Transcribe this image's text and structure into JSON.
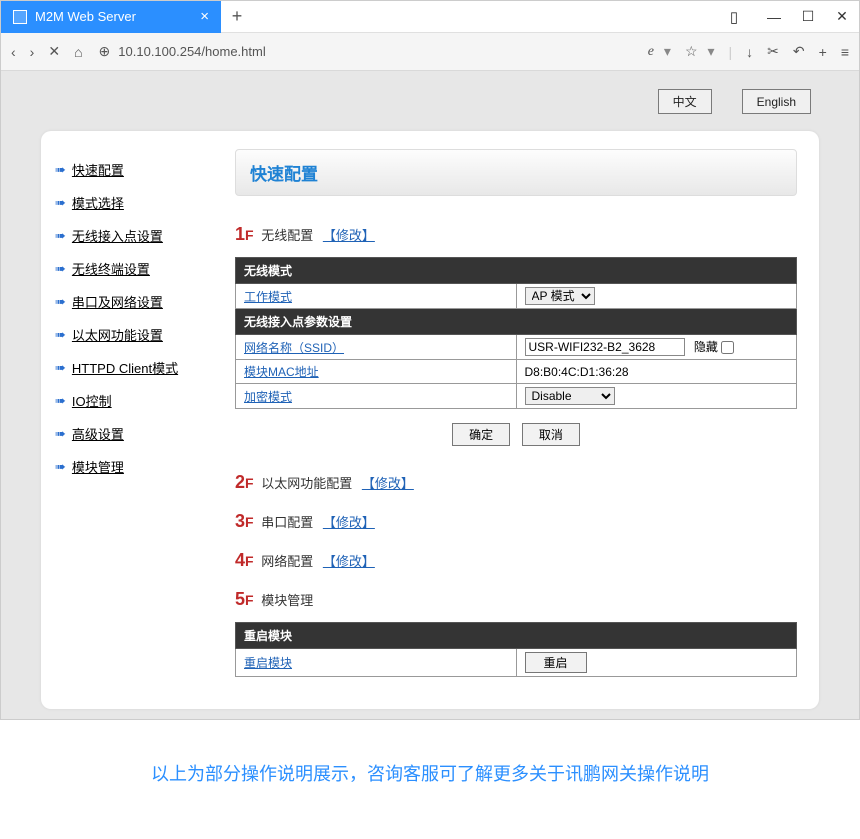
{
  "titlebar": {
    "tab_title": "M2M Web Server",
    "new_tab": "+",
    "close_tab": "×",
    "win_min": "—",
    "win_max": "☐",
    "win_close": "✕",
    "reader": "▯"
  },
  "toolbar": {
    "back": "‹",
    "forward": "›",
    "stop": "✕",
    "home": "⌂",
    "lock": "⊕",
    "url": "10.10.100.254/home.html",
    "compat": "e",
    "fav": "☆",
    "download": "↓",
    "cut": "✂",
    "undo": "↶",
    "plus": "+",
    "menu": "≡"
  },
  "lang": {
    "cn": "中文",
    "en": "English"
  },
  "sidebar": {
    "items": [
      {
        "label": "快速配置"
      },
      {
        "label": "模式选择"
      },
      {
        "label": "无线接入点设置"
      },
      {
        "label": "无线终端设置"
      },
      {
        "label": "串口及网络设置"
      },
      {
        "label": "以太网功能设置"
      },
      {
        "label": "HTTPD Client模式"
      },
      {
        "label": "IO控制"
      },
      {
        "label": "高级设置"
      },
      {
        "label": "模块管理"
      }
    ]
  },
  "main": {
    "title": "快速配置",
    "steps": {
      "s1": {
        "num": "1",
        "f": "F",
        "label": "无线配置",
        "edit": "【修改】"
      },
      "s2": {
        "num": "2",
        "f": "F",
        "label": "以太网功能配置",
        "edit": "【修改】"
      },
      "s3": {
        "num": "3",
        "f": "F",
        "label": "串口配置",
        "edit": "【修改】"
      },
      "s4": {
        "num": "4",
        "f": "F",
        "label": "网络配置",
        "edit": "【修改】"
      },
      "s5": {
        "num": "5",
        "f": "F",
        "label": "模块管理"
      }
    },
    "table1": {
      "hdr_mode": "无线模式",
      "row_workmode": "工作模式",
      "workmode_value": "AP 模式",
      "hdr_ap": "无线接入点参数设置",
      "row_ssid": "网络名称（SSID）",
      "ssid_value": "USR-WIFI232-B2_3628",
      "hide_label": "隐藏",
      "row_mac": "模块MAC地址",
      "mac_value": "D8:B0:4C:D1:36:28",
      "row_enc": "加密模式",
      "enc_value": "Disable"
    },
    "btns": {
      "ok": "确定",
      "cancel": "取消"
    },
    "table2": {
      "hdr": "重启模块",
      "row_label": "重启模块",
      "btn": "重启"
    }
  },
  "caption": "以上为部分操作说明展示，咨询客服可了解更多关于讯鹏网关操作说明"
}
